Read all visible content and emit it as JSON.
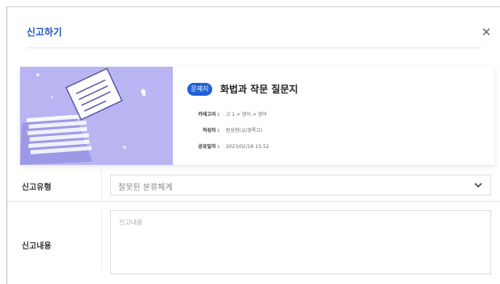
{
  "modal": {
    "title": "신고하기",
    "close_icon": "close-icon"
  },
  "document": {
    "badge": "문제지",
    "title": "화법과 작문 질문지",
    "meta": [
      {
        "label": "카테고리 :",
        "value": "고 1 > 영어 > 영어"
      },
      {
        "label": "작성자 :",
        "value": "원상현(교/경록고)"
      },
      {
        "label": "공유일자 :",
        "value": "2023/02/16 15:52"
      }
    ],
    "thumbnail_icon": "document-stack-illustration"
  },
  "form": {
    "type_label": "신고유형",
    "type_value": "잘못된 분류체계",
    "type_chevron_icon": "chevron-down-icon",
    "content_label": "신고내용",
    "content_placeholder": "신고내용"
  },
  "colors": {
    "accent": "#1f56c9",
    "badge": "#1f62d6",
    "thumbnail_bg": "#b8b5f2"
  }
}
